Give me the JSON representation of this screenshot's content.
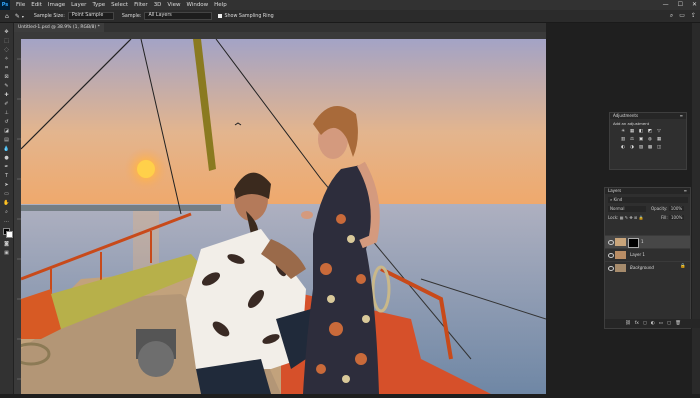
{
  "menubar": {
    "logo": "Ps",
    "items": [
      "File",
      "Edit",
      "Image",
      "Layer",
      "Type",
      "Select",
      "Filter",
      "3D",
      "View",
      "Window",
      "Help"
    ],
    "controls": [
      "—",
      "☐",
      "✕"
    ]
  },
  "options": {
    "sample_size_label": "Sample Size:",
    "sample_size_value": "Point Sample",
    "sample_label": "Sample:",
    "sample_value": "All Layers",
    "sampling_ring_label": "Show Sampling Ring"
  },
  "document": {
    "tab_title": "Untitled-1.psd @ 38.9% (1, RGB/8) *"
  },
  "adjustments_panel": {
    "title": "Adjustments",
    "subtitle": "Add an adjustment",
    "icons": [
      "☀",
      "▦",
      "◧",
      "◩",
      "▽",
      "",
      "▥",
      "⚖",
      "▣",
      "◍",
      "▦",
      "",
      "◐",
      "◑",
      "▨",
      "▩",
      "◫",
      ""
    ]
  },
  "layers_panel": {
    "title": "Layers",
    "filter_label": "Kind",
    "blend_mode": "Normal",
    "opacity_label": "Opacity:",
    "opacity_value": "100%",
    "lock_label": "Lock:",
    "fill_label": "Fill:",
    "fill_value": "100%",
    "layers": [
      {
        "name": "1",
        "selected": true
      },
      {
        "name": "Layer 1",
        "selected": false
      },
      {
        "name": "Background",
        "selected": false
      }
    ],
    "footer_icons": [
      "⛓",
      "fx",
      "◻",
      "◐",
      "▭",
      "▢",
      "🗑"
    ]
  },
  "colors": {
    "accent": "#31a8ff",
    "sky_top": "#9f9cc1",
    "sky_bottom": "#e9b47f",
    "sea": "#7a8aa3",
    "sun": "#ffcc44",
    "rail": "#c84a1a"
  }
}
